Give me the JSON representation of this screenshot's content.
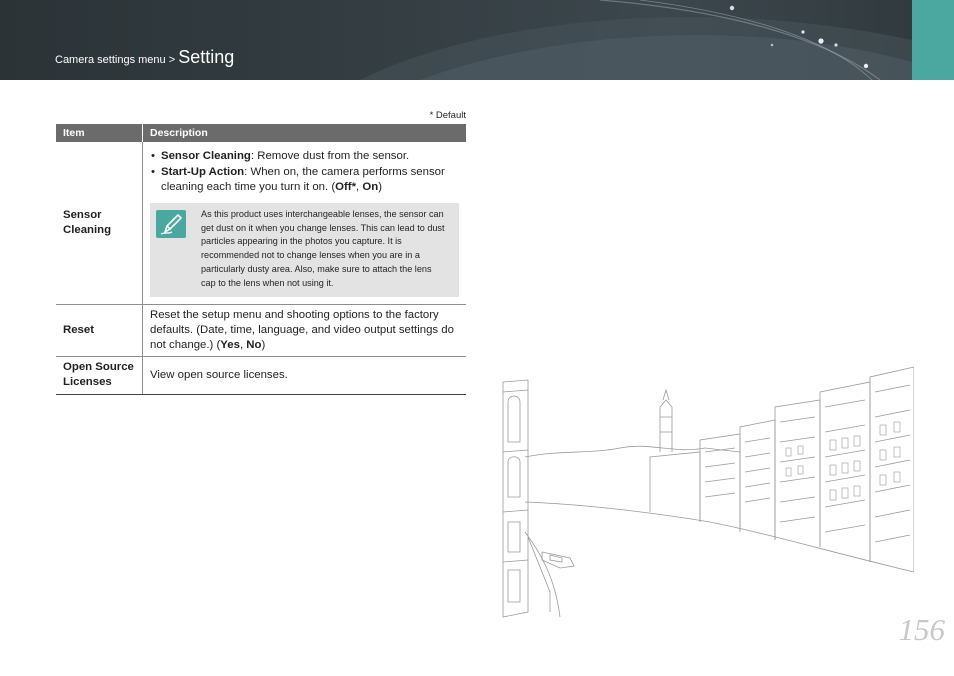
{
  "header": {
    "breadcrumb_parent": "Camera settings menu",
    "breadcrumb_separator": " > ",
    "title": "Setting",
    "accent_color": "#4aa8a0",
    "banner_color": "#353f44"
  },
  "table": {
    "default_note": "* Default",
    "headers": {
      "item": "Item",
      "description": "Description"
    },
    "rows": [
      {
        "item": "Sensor Cleaning",
        "bullets": [
          {
            "term": "Sensor Cleaning",
            "text": ": Remove dust from the sensor."
          },
          {
            "term": "Start-Up Action",
            "text": ": When on, the camera performs sensor cleaning each time you turn it on. (",
            "opt1": "Off*",
            "sep": ", ",
            "opt2": "On",
            "close": ")"
          }
        ],
        "note": {
          "icon": "pencil-note-icon",
          "text": "As this product uses interchangeable lenses, the sensor can get dust on it when you change lenses. This can lead to dust particles appearing in the photos you capture. It is recommended not to change lenses when you are in a particularly dusty area. Also, make sure to attach the lens cap to the lens when not using it."
        }
      },
      {
        "item": "Reset",
        "text": "Reset the setup menu and shooting options to the factory defaults. (Date, time, language, and video output settings do not change.) (",
        "opt1": "Yes",
        "sep": ", ",
        "opt2": "No",
        "close": ")"
      },
      {
        "item": "Open Source Licenses",
        "text": "View open source licenses."
      }
    ]
  },
  "page_number": "156"
}
